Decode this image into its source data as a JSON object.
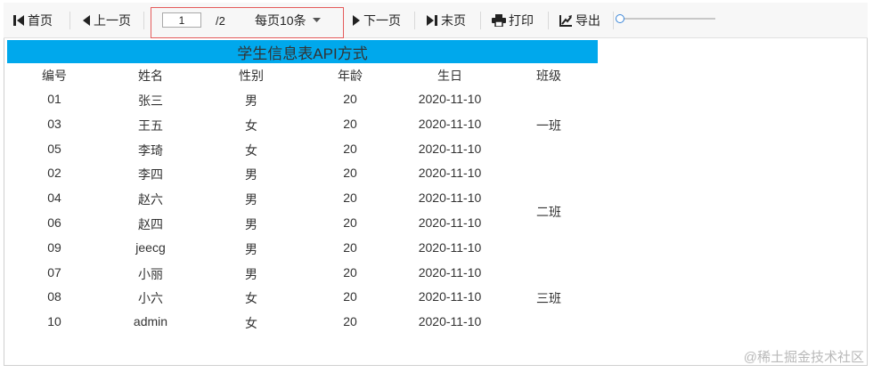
{
  "toolbar": {
    "first_label": "首页",
    "prev_label": "上一页",
    "page_value": "1",
    "page_total": "/2",
    "page_size_label": "每页10条",
    "next_label": "下一页",
    "last_label": "末页",
    "print_label": "打印",
    "export_label": "导出",
    "zoom_fraction": 0.0
  },
  "report": {
    "title": "学生信息表API方式",
    "columns": [
      "编号",
      "姓名",
      "性别",
      "年龄",
      "生日",
      "班级"
    ],
    "rows": [
      {
        "id": "01",
        "name": "张三",
        "gender": "男",
        "age": "20",
        "birthday": "2020-11-10"
      },
      {
        "id": "03",
        "name": "王五",
        "gender": "女",
        "age": "20",
        "birthday": "2020-11-10"
      },
      {
        "id": "05",
        "name": "李琦",
        "gender": "女",
        "age": "20",
        "birthday": "2020-11-10"
      },
      {
        "id": "02",
        "name": "李四",
        "gender": "男",
        "age": "20",
        "birthday": "2020-11-10"
      },
      {
        "id": "04",
        "name": "赵六",
        "gender": "男",
        "age": "20",
        "birthday": "2020-11-10"
      },
      {
        "id": "06",
        "name": "赵四",
        "gender": "男",
        "age": "20",
        "birthday": "2020-11-10"
      },
      {
        "id": "09",
        "name": "jeecg",
        "gender": "男",
        "age": "20",
        "birthday": "2020-11-10"
      },
      {
        "id": "07",
        "name": "小丽",
        "gender": "男",
        "age": "20",
        "birthday": "2020-11-10"
      },
      {
        "id": "08",
        "name": "小六",
        "gender": "女",
        "age": "20",
        "birthday": "2020-11-10"
      },
      {
        "id": "10",
        "name": "admin",
        "gender": "女",
        "age": "20",
        "birthday": "2020-11-10"
      }
    ],
    "classes": [
      {
        "label": "一班",
        "rows": [
          0,
          2
        ]
      },
      {
        "label": "二班",
        "rows": [
          3,
          6
        ]
      },
      {
        "label": "三班",
        "rows": [
          7,
          9
        ]
      }
    ]
  },
  "watermark": "@稀土掘金技术社区"
}
